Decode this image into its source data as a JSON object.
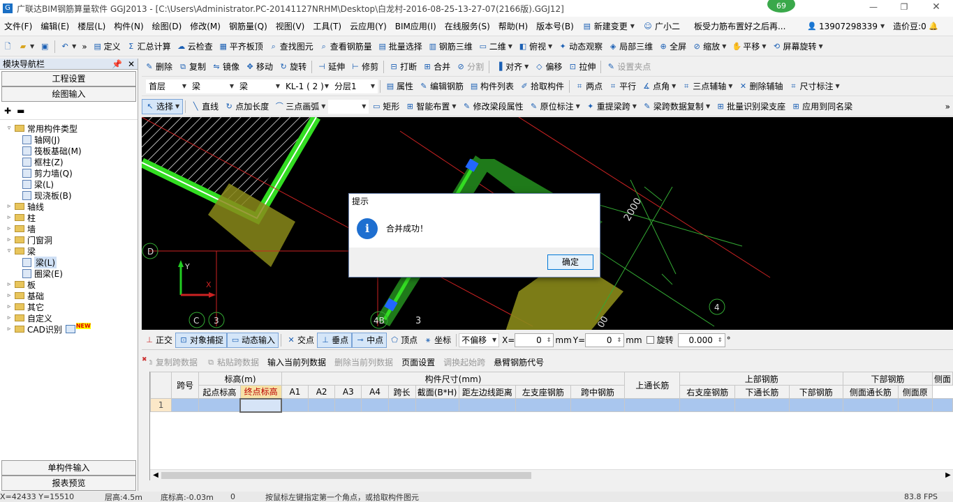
{
  "window": {
    "title": "广联达BIM钢筋算量软件 GGJ2013 - [C:\\Users\\Administrator.PC-20141127NRHM\\Desktop\\白龙村-2016-08-25-13-27-07(2166版).GGJ12]",
    "badge": "69"
  },
  "menu": {
    "items": [
      "文件(F)",
      "编辑(E)",
      "楼层(L)",
      "构件(N)",
      "绘图(D)",
      "修改(M)",
      "钢筋量(Q)",
      "视图(V)",
      "工具(T)",
      "云应用(Y)",
      "BIM应用(I)",
      "在线服务(S)",
      "帮助(H)",
      "版本号(B)"
    ],
    "new_change": "新建变更",
    "assistant": "广小二",
    "notice": "板受力筋布置好之后再...",
    "phone": "13907298339",
    "price": "造价豆:0"
  },
  "toolbar1": {
    "items": [
      "定义",
      "汇总计算",
      "云检查",
      "平齐板顶",
      "查找图元",
      "查看钢筋量",
      "批量选择",
      "钢筋三维",
      "二维",
      "俯视",
      "动态观察",
      "局部三维",
      "全屏",
      "缩放",
      "平移",
      "屏幕旋转"
    ]
  },
  "toolbar2": {
    "items": [
      "删除",
      "复制",
      "镜像",
      "移动",
      "旋转",
      "延伸",
      "修剪",
      "打断",
      "合并",
      "分割",
      "对齐",
      "偏移",
      "拉伸",
      "设置夹点"
    ]
  },
  "toolbar3": {
    "floor": "首层",
    "type": "梁",
    "subtype": "梁",
    "component": "KL-1 ( 2 )",
    "layer": "分层1",
    "items": [
      "属性",
      "编辑钢筋",
      "构件列表",
      "拾取构件",
      "两点",
      "平行",
      "点角",
      "三点辅轴",
      "删除辅轴",
      "尺寸标注"
    ]
  },
  "toolbar4": {
    "items": [
      "选择",
      "直线",
      "点加长度",
      "三点画弧",
      "矩形",
      "智能布置",
      "修改梁段属性",
      "原位标注",
      "重提梁跨",
      "梁跨数据复制",
      "批量识别梁支座",
      "应用到同名梁"
    ]
  },
  "nav": {
    "title": "模块导航栏",
    "btn_project": "工程设置",
    "btn_draw": "绘图输入",
    "tree": [
      {
        "label": "常用构件类型",
        "level": 0,
        "expanded": true,
        "folder": true
      },
      {
        "label": "轴网(J)",
        "level": 1
      },
      {
        "label": "筏板基础(M)",
        "level": 1
      },
      {
        "label": "框柱(Z)",
        "level": 1
      },
      {
        "label": "剪力墙(Q)",
        "level": 1
      },
      {
        "label": "梁(L)",
        "level": 1
      },
      {
        "label": "现浇板(B)",
        "level": 1
      },
      {
        "label": "轴线",
        "level": 0,
        "folder": true
      },
      {
        "label": "柱",
        "level": 0,
        "folder": true
      },
      {
        "label": "墙",
        "level": 0,
        "folder": true
      },
      {
        "label": "门窗洞",
        "level": 0,
        "folder": true
      },
      {
        "label": "梁",
        "level": 0,
        "expanded": true,
        "folder": true
      },
      {
        "label": "梁(L)",
        "level": 1,
        "selected": true
      },
      {
        "label": "圈梁(E)",
        "level": 1
      },
      {
        "label": "板",
        "level": 0,
        "folder": true
      },
      {
        "label": "基础",
        "level": 0,
        "folder": true
      },
      {
        "label": "其它",
        "level": 0,
        "folder": true
      },
      {
        "label": "自定义",
        "level": 0,
        "folder": true
      },
      {
        "label": "CAD识别",
        "level": 0,
        "folder": true,
        "new": "NEW"
      }
    ],
    "btn_single": "单构件输入",
    "btn_report": "报表预览"
  },
  "canvas": {
    "axis_labels": [
      "D",
      "C",
      "3",
      "4B",
      "3",
      "4"
    ],
    "dim_text": "2000",
    "dim_text2": "00",
    "ucs_x": "X",
    "ucs_y": "Y"
  },
  "dialog": {
    "title": "提示",
    "message": "合并成功！",
    "ok": "确定"
  },
  "snapbar": {
    "ortho": "正交",
    "osnap": "对象捕捉",
    "dyn": "动态输入",
    "intersect": "交点",
    "perp": "垂点",
    "mid": "中点",
    "vertex": "顶点",
    "coord": "坐标",
    "offset": "不偏移",
    "x_label": "X=",
    "x_val": "0",
    "unit": "mm",
    "y_label": "Y=",
    "y_val": "0",
    "rotate": "旋转",
    "rot_val": "0.000",
    "deg": "°"
  },
  "gridtools": {
    "items": [
      "复制跨数据",
      "粘贴跨数据",
      "输入当前列数据",
      "删除当前列数据",
      "页面设置",
      "调换起始跨",
      "悬臂钢筋代号"
    ]
  },
  "grid": {
    "group_headers": [
      "跨号",
      "标高(m)",
      "构件尺寸(mm)",
      "上通长筋",
      "上部钢筋",
      "下部钢筋",
      "侧面"
    ],
    "sub_headers": [
      "起点标高",
      "终点标高",
      "A1",
      "A2",
      "A3",
      "A4",
      "跨长",
      "截面(B*H)",
      "距左边线距离",
      "左支座钢筋",
      "跨中钢筋",
      "右支座钢筋",
      "下通长筋",
      "下部钢筋",
      "侧面通长筋",
      "侧面原"
    ],
    "row_num": "1"
  },
  "status": {
    "coords": "X=42433 Y=15510",
    "floor_height": "层高:4.5m",
    "bottom": "底标高:-0.03m",
    "zero": "0",
    "hint": "按鼠标左键指定第一个角点，或拾取构件图元",
    "fps": "83.8 FPS"
  }
}
